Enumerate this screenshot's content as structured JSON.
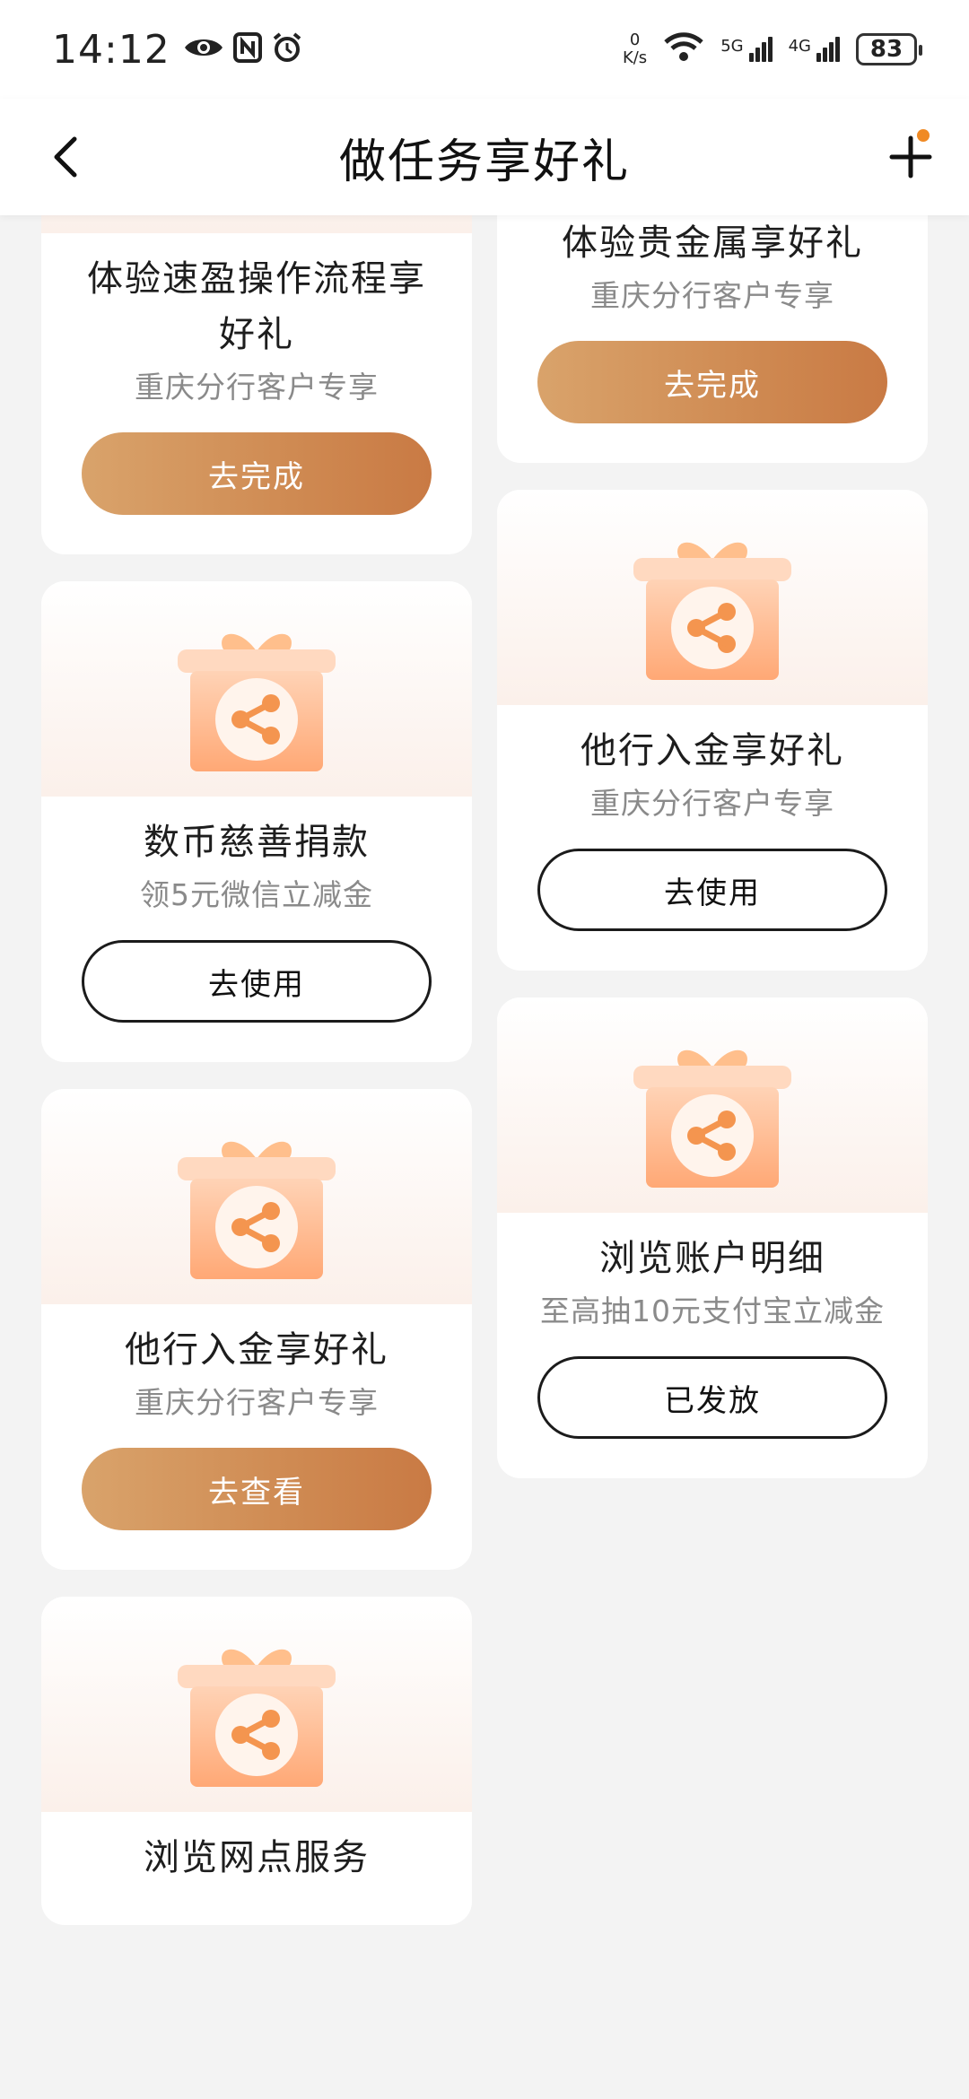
{
  "status_bar": {
    "time": "14:12",
    "net_speed_value": "0",
    "net_speed_unit": "K/s",
    "sig1_label": "5G",
    "sig2_label": "4G",
    "battery": "83"
  },
  "header": {
    "title": "做任务享好礼"
  },
  "left_column": [
    {
      "title": "体验速盈操作流程享好礼",
      "subtitle": "重庆分行客户专享",
      "button": "去完成"
    },
    {
      "title": "数币慈善捐款",
      "subtitle": "领5元微信立减金",
      "button": "去使用"
    },
    {
      "title": "他行入金享好礼",
      "subtitle": "重庆分行客户专享",
      "button": "去查看"
    },
    {
      "title": "浏览网点服务",
      "subtitle": "",
      "button": ""
    }
  ],
  "right_column": [
    {
      "title": "体验贵金属享好礼",
      "subtitle": "重庆分行客户专享",
      "button": "去完成"
    },
    {
      "title": "他行入金享好礼",
      "subtitle": "重庆分行客户专享",
      "button": "去使用"
    },
    {
      "title": "浏览账户明细",
      "subtitle": "至高抽10元支付宝立减金",
      "button": "已发放"
    }
  ],
  "colors": {
    "accent_gradient_start": "#d9a36b",
    "accent_gradient_end": "#c97a44",
    "badge_dot": "#f08a24"
  }
}
